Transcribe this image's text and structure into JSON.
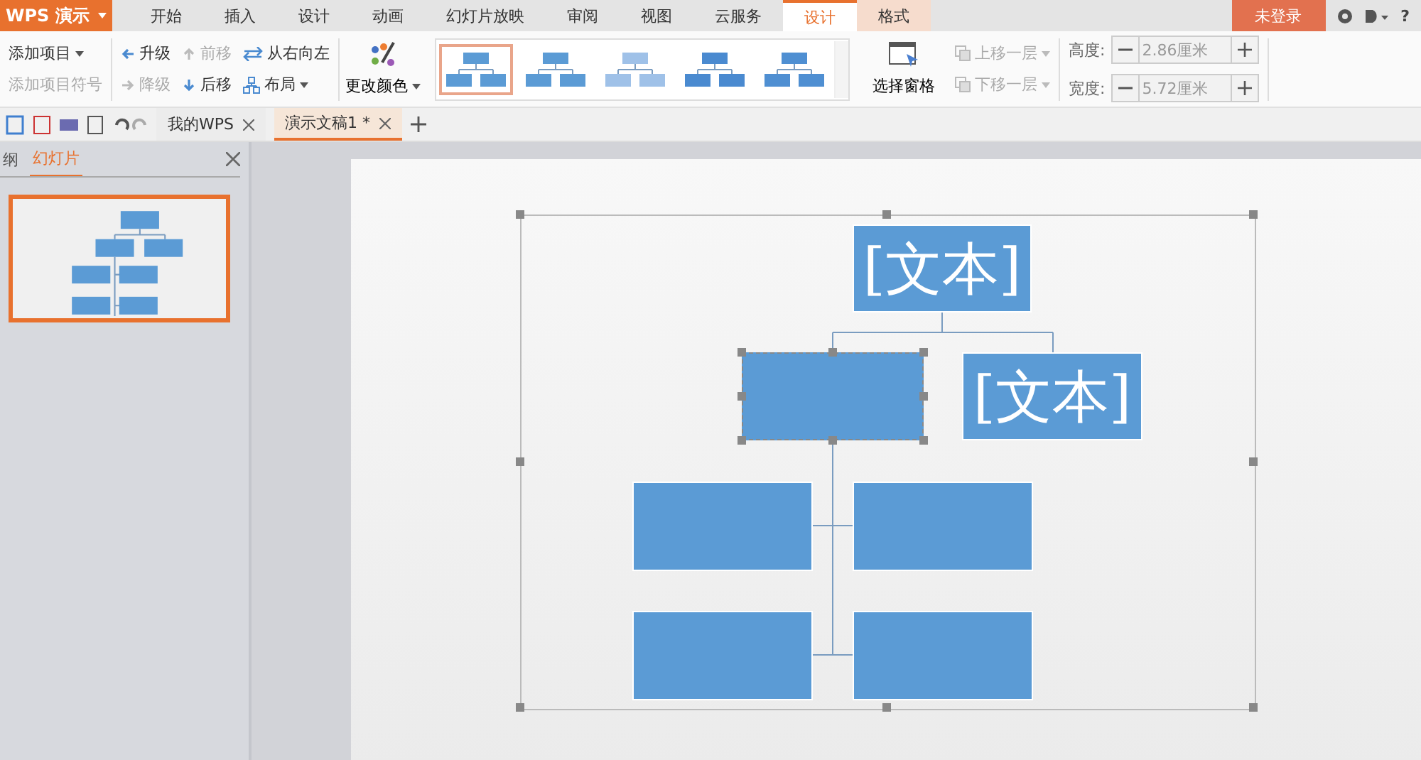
{
  "app_menu": {
    "label": "WPS 演示"
  },
  "menu_tabs": [
    {
      "label": "开始",
      "selected": false
    },
    {
      "label": "插入",
      "selected": false
    },
    {
      "label": "设计",
      "selected": false
    },
    {
      "label": "动画",
      "selected": false
    },
    {
      "label": "幻灯片放映",
      "selected": false
    },
    {
      "label": "审阅",
      "selected": false
    },
    {
      "label": "视图",
      "selected": false
    },
    {
      "label": "云服务",
      "selected": false
    },
    {
      "label": "设计",
      "selected": true
    },
    {
      "label": "格式",
      "selected": false
    }
  ],
  "login_button": "未登录",
  "title_icons": [
    "?"
  ],
  "ribbon": {
    "add_item": "添加项目",
    "add_bullet": "添加项目符号",
    "promote": "升级",
    "demote": "降级",
    "move_up": "前移",
    "move_down": "后移",
    "right_to_left": "从右向左",
    "layout": "布局",
    "change_color": "更改颜色",
    "styles": [
      {
        "kind": "flat",
        "selected": true
      },
      {
        "kind": "flat",
        "selected": false
      },
      {
        "kind": "light",
        "selected": false
      },
      {
        "kind": "dark",
        "selected": false
      },
      {
        "kind": "shadow",
        "selected": false
      }
    ],
    "selection_pane": "选择窗格",
    "bring_forward": "上移一层",
    "send_backward": "下移一层",
    "height_label": "高度:",
    "height_value": "2.86厘米",
    "width_label": "宽度:",
    "width_value": "5.72厘米"
  },
  "doc_tabs": [
    {
      "label": "我的WPS",
      "selected": false
    },
    {
      "label": "演示文稿1 *",
      "selected": true
    }
  ],
  "panel_tabs": [
    {
      "label": "纲",
      "selected": false
    },
    {
      "label": "幻灯片",
      "selected": true
    }
  ],
  "diagram": {
    "selected": true,
    "nodes": [
      {
        "text": "[文本]",
        "selected": false
      },
      {
        "selected": true
      },
      {
        "text": "[文本]",
        "selected": false
      },
      {
        "selected": false
      },
      {
        "selected": false
      },
      {
        "selected": false
      },
      {
        "selected": false
      }
    ]
  }
}
